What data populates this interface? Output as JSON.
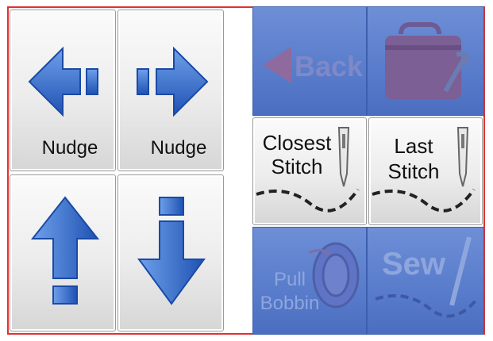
{
  "left_panel": {
    "nudge_left_label": "Nudge",
    "nudge_right_label": "Nudge"
  },
  "right_panel": {
    "back_label": "Back",
    "closest_stitch_label_1": "Closest",
    "closest_stitch_label_2": "Stitch",
    "last_stitch_label_1": "Last",
    "last_stitch_label_2": "Stitch",
    "pull_bobbin_label_1": "Pull",
    "pull_bobbin_label_2": "Bobbin",
    "sew_label": "Sew"
  },
  "colors": {
    "frame_border": "#e23030",
    "panel_blue": "#5a7dcc",
    "arrow_blue": "#2f66c9",
    "disabled_text": "#8ea6dd"
  },
  "icons": [
    "arrow-left-icon",
    "arrow-right-icon",
    "arrow-up-icon",
    "arrow-down-icon",
    "back-triangle-icon",
    "toolbox-wrench-icon",
    "needle-icon",
    "bobbin-icon",
    "sew-needle-icon"
  ]
}
